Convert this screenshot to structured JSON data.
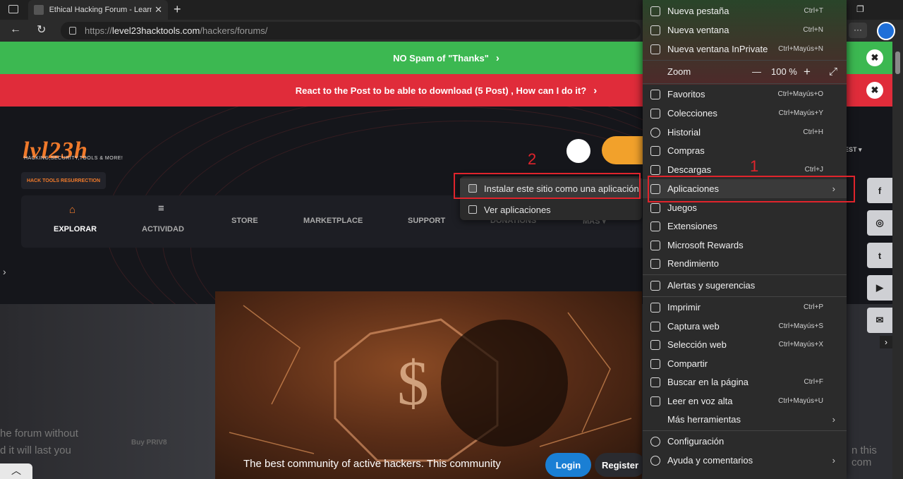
{
  "tab": {
    "title": "Ethical Hacking Forum - Learn and",
    "close": "✕",
    "new": "+"
  },
  "address": {
    "scheme": "https://",
    "host": "level23hacktools.com",
    "path": "/hackers/forums/"
  },
  "banners": {
    "green": "NO Spam of \"Thanks\"",
    "red": "React to the Post to be able to download (5 Post) , How can I do it?",
    "chevron": "›",
    "close": "✖"
  },
  "site": {
    "logo": "lvl23h",
    "logo_sub": "HACKING,SECURITY,TOOLS & MORE!",
    "badge": "HACK TOOLS RESURRECTION",
    "nav": [
      {
        "label": "EXPLORAR",
        "icon": "home-icon"
      },
      {
        "label": "ACTIVIDAD",
        "icon": "menu-icon"
      },
      {
        "label": "STORE"
      },
      {
        "label": "MARKETPLACE"
      },
      {
        "label": "SUPPORT"
      },
      {
        "label": "DONATIONS"
      },
      {
        "label": "MÁS ▾"
      }
    ],
    "guest": "EST ▾",
    "hero_text": "The best community of active hackers. This community",
    "left_text_1": "he forum without",
    "left_text_2": "d it will last you",
    "buy": "Buy PRIV8",
    "right_text": "n this com",
    "login": "Login",
    "register": "Register"
  },
  "apps_menu": {
    "install": "Instalar este sitio como una aplicación",
    "view": "Ver aplicaciones"
  },
  "menu": {
    "items": [
      {
        "label": "Nueva pestaña",
        "shortcut": "Ctrl+T"
      },
      {
        "label": "Nueva ventana",
        "shortcut": "Ctrl+N"
      },
      {
        "label": "Nueva ventana InPrivate",
        "shortcut": "Ctrl+Mayús+N"
      },
      {
        "label": "Zoom",
        "zoom_value": "100 %",
        "minus": "—",
        "plus": "+",
        "expand": "⤢"
      },
      {
        "label": "Favoritos",
        "shortcut": "Ctrl+Mayús+O"
      },
      {
        "label": "Colecciones",
        "shortcut": "Ctrl+Mayús+Y"
      },
      {
        "label": "Historial",
        "shortcut": "Ctrl+H"
      },
      {
        "label": "Compras"
      },
      {
        "label": "Descargas",
        "shortcut": "Ctrl+J"
      },
      {
        "label": "Aplicaciones",
        "chevron": "›"
      },
      {
        "label": "Juegos"
      },
      {
        "label": "Extensiones"
      },
      {
        "label": "Microsoft Rewards"
      },
      {
        "label": "Rendimiento"
      },
      {
        "label": "Alertas y sugerencias"
      },
      {
        "label": "Imprimir",
        "shortcut": "Ctrl+P"
      },
      {
        "label": "Captura web",
        "shortcut": "Ctrl+Mayús+S"
      },
      {
        "label": "Selección web",
        "shortcut": "Ctrl+Mayús+X"
      },
      {
        "label": "Compartir"
      },
      {
        "label": "Buscar en la página",
        "shortcut": "Ctrl+F"
      },
      {
        "label": "Leer en voz alta",
        "shortcut": "Ctrl+Mayús+U"
      },
      {
        "label": "Más herramientas",
        "chevron": "›"
      },
      {
        "label": "Configuración"
      },
      {
        "label": "Ayuda y comentarios",
        "chevron": "›"
      }
    ]
  },
  "annotations": {
    "one": "1",
    "two": "2"
  },
  "social": [
    "f",
    "◎",
    "t",
    "▶",
    "✉"
  ],
  "window": {
    "restore": "❐",
    "more": "···"
  }
}
